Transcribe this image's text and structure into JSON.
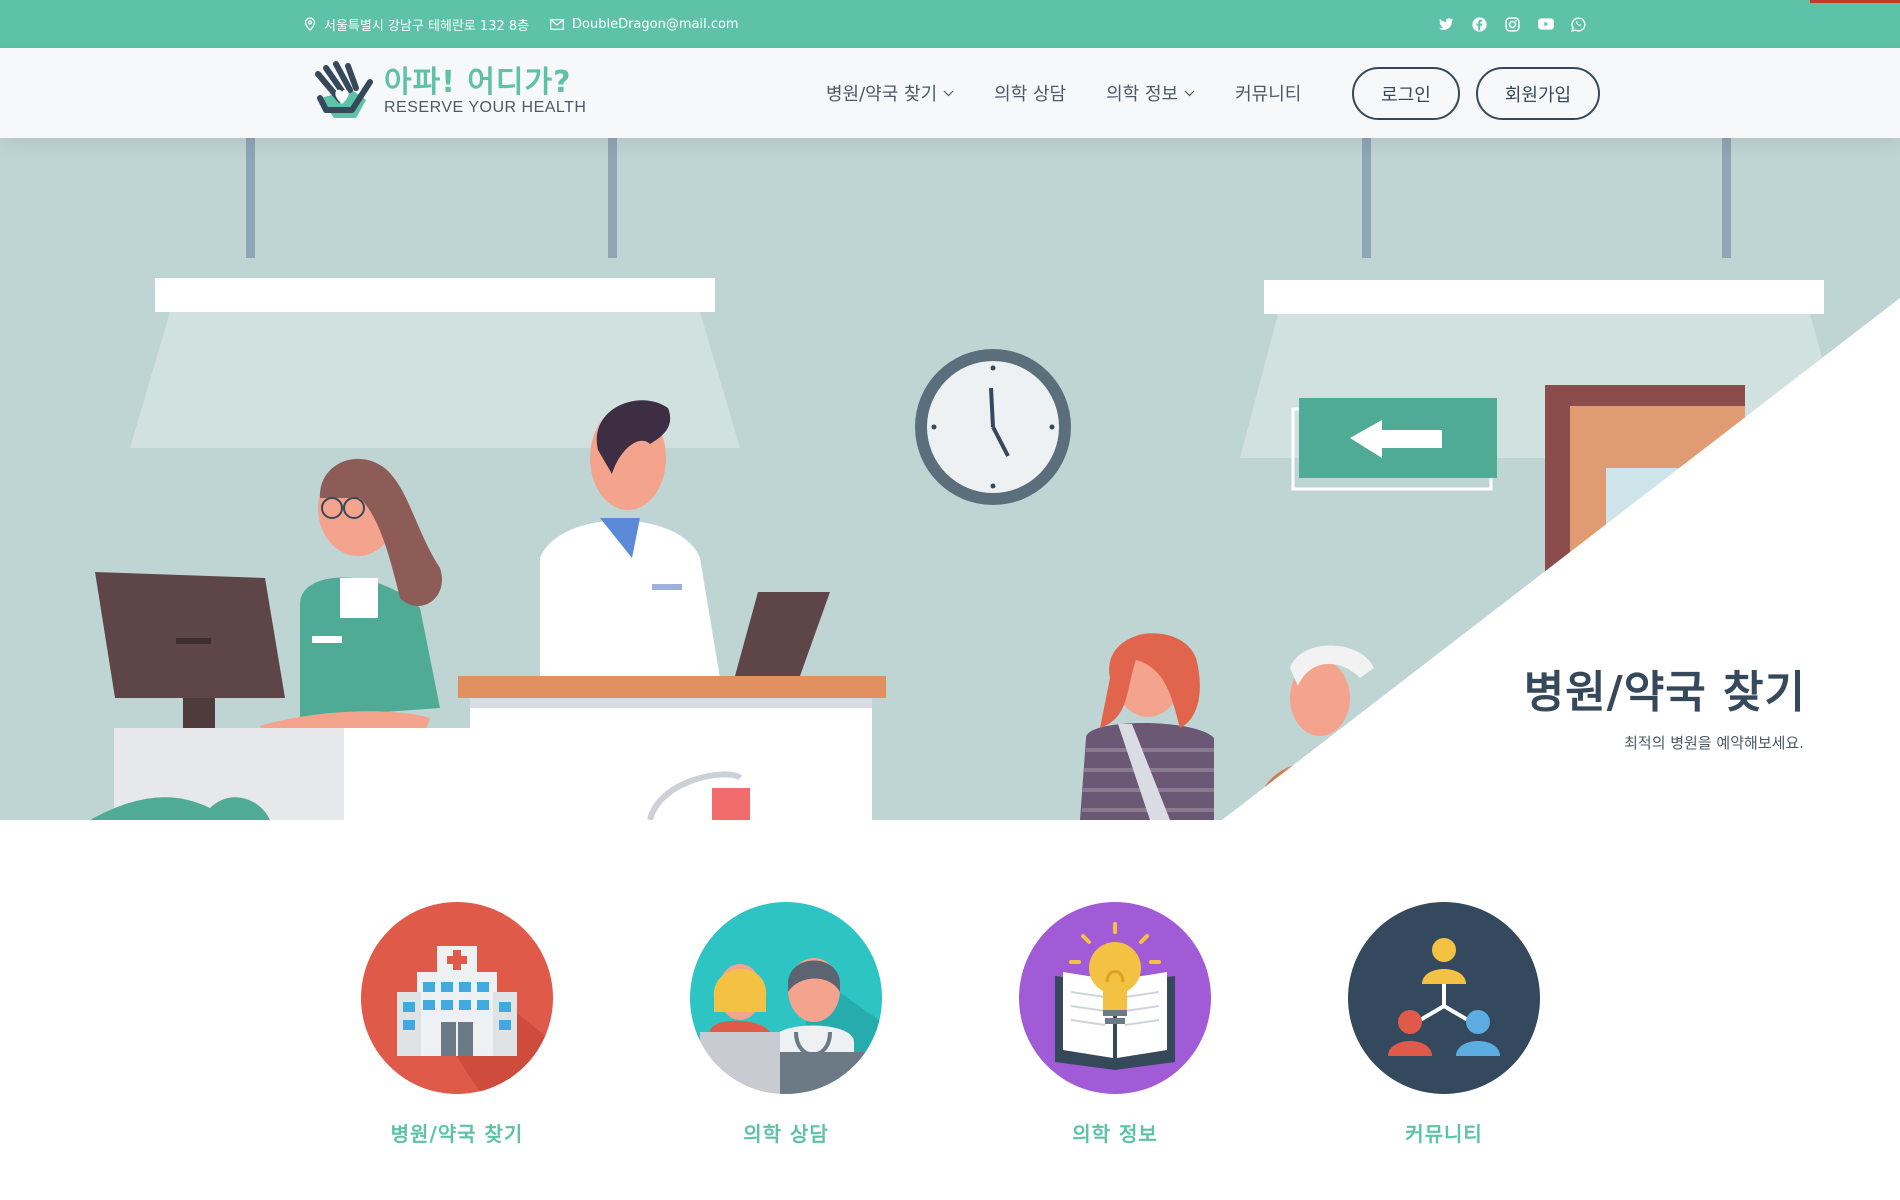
{
  "topbar": {
    "address": "서울특별시 강남구 테헤란로 132 8층",
    "email": "DoubleDragon@mail.com",
    "social_icons": [
      "twitter-icon",
      "facebook-icon",
      "instagram-icon",
      "youtube-icon",
      "whatsapp-icon"
    ]
  },
  "header": {
    "logo_title": "아파! 어디가?",
    "logo_subtitle": "RESERVE YOUR HEALTH",
    "nav": [
      {
        "label": "병원/약국 찾기",
        "dropdown": true
      },
      {
        "label": "의학 상담",
        "dropdown": false
      },
      {
        "label": "의학 정보",
        "dropdown": true
      },
      {
        "label": "커뮤니티",
        "dropdown": false
      }
    ],
    "login_label": "로그인",
    "signup_label": "회원가입"
  },
  "hero": {
    "title": "병원/약국 찾기",
    "subtitle": "최적의 병원을 예약해보세요."
  },
  "features": [
    {
      "label": "병원/약국 찾기",
      "icon": "hospital-icon",
      "color": "#e05a4a"
    },
    {
      "label": "의학 상담",
      "icon": "consultation-icon",
      "color": "#2ec4c4"
    },
    {
      "label": "의학 정보",
      "icon": "book-bulb-icon",
      "color": "#a25bd6"
    },
    {
      "label": "커뮤니티",
      "icon": "community-icon",
      "color": "#34495e"
    }
  ],
  "colors": {
    "accent": "#5ec2a8",
    "dark": "#36495a"
  }
}
